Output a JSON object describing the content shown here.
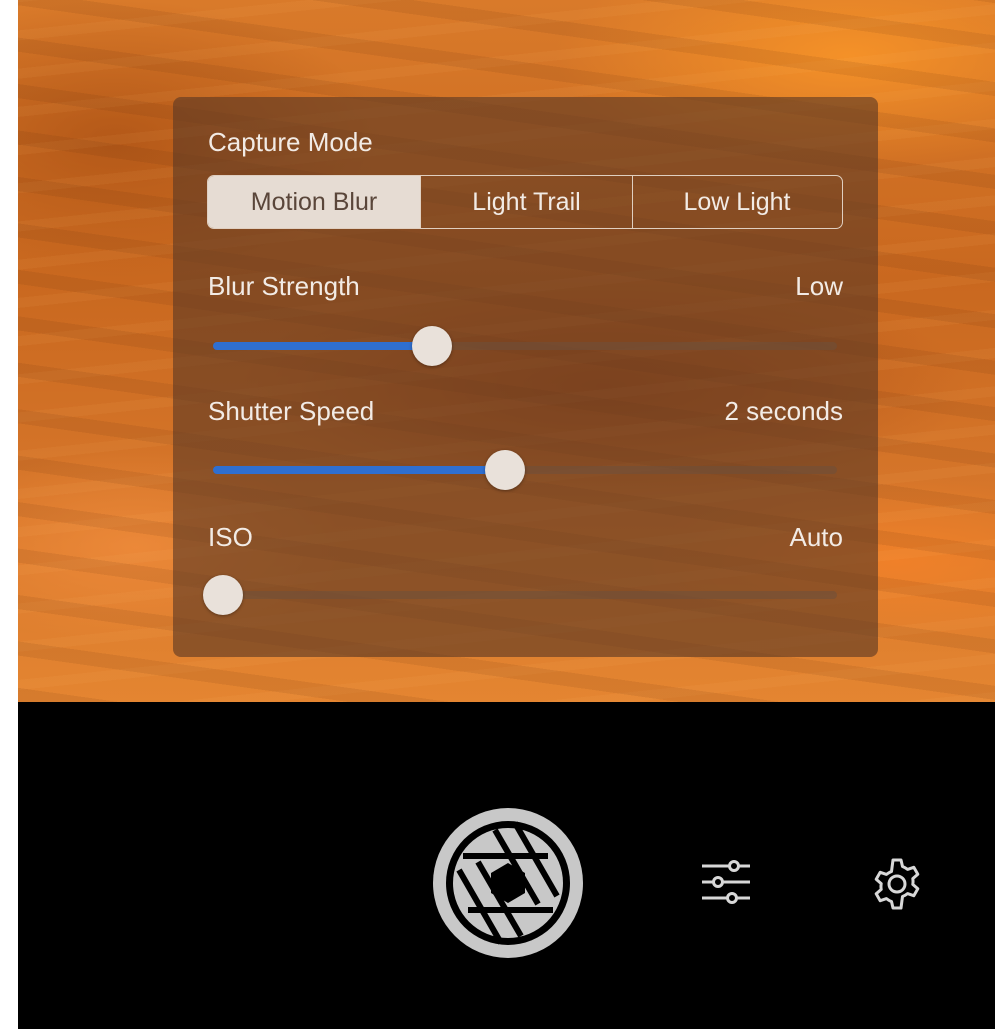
{
  "panel": {
    "capture_mode": {
      "title": "Capture Mode",
      "options": [
        "Motion Blur",
        "Light Trail",
        "Low Light"
      ],
      "selected": "Motion Blur"
    },
    "blur_strength": {
      "label": "Blur Strength",
      "value": "Low",
      "level": 0.34
    },
    "shutter_speed": {
      "label": "Shutter Speed",
      "value": "2 seconds",
      "level": 0.46
    },
    "iso": {
      "label": "ISO",
      "value": "Auto",
      "level": 0.0
    }
  },
  "controls": {
    "shutter_icon": "aperture-shutter-icon",
    "adjust_icon": "sliders-icon",
    "settings_icon": "gear-icon"
  },
  "colors": {
    "slider_fill": "#2f6fd0",
    "selected_segment": "#e6dcd3",
    "shutter_button": "#c8c8c8"
  }
}
